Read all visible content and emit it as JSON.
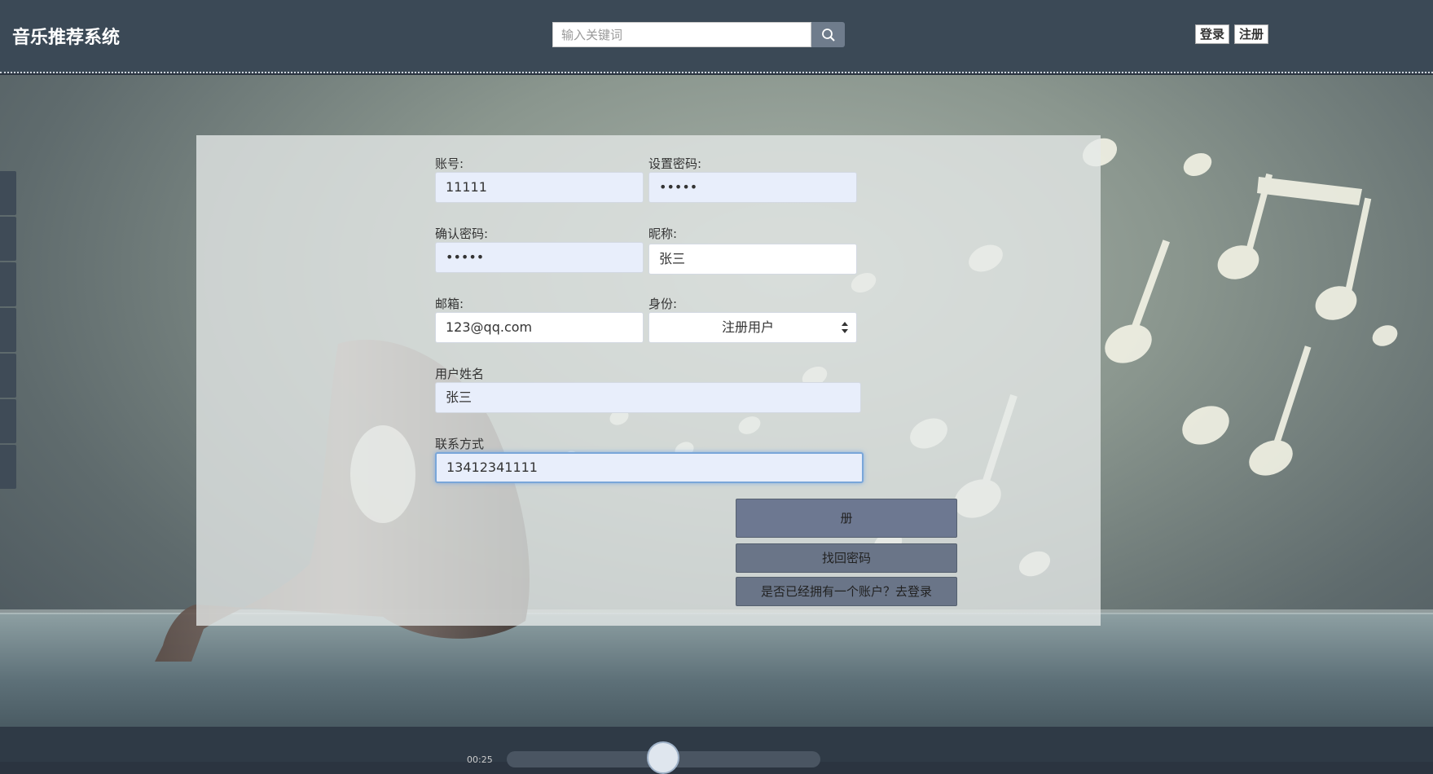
{
  "header": {
    "brand": "音乐推荐系统",
    "search_placeholder": "输入关键词",
    "login": "登录",
    "register": "注册"
  },
  "form": {
    "account_label": "账号:",
    "account_value": "11111",
    "password_label": "设置密码:",
    "password_value": "•••••",
    "confirm_label": "确认密码:",
    "confirm_value": "•••••",
    "nickname_label": "昵称:",
    "nickname_value": "张三",
    "email_label": "邮箱:",
    "email_value": "123@qq.com",
    "role_label": "身份:",
    "role_value": "注册用户",
    "realname_label": "用户姓名",
    "realname_value": "张三",
    "contact_label": "联系方式",
    "contact_value": "13412341111",
    "register_button": "册",
    "find_password_button": "找回密码",
    "go_login_button": "是否已经拥有一个账户？去登录"
  },
  "colors": {
    "header_bg": "#3b4956",
    "button_bg": "#6a7588",
    "input_bg": "#e8eefb"
  },
  "player": {
    "time": "00:25"
  }
}
